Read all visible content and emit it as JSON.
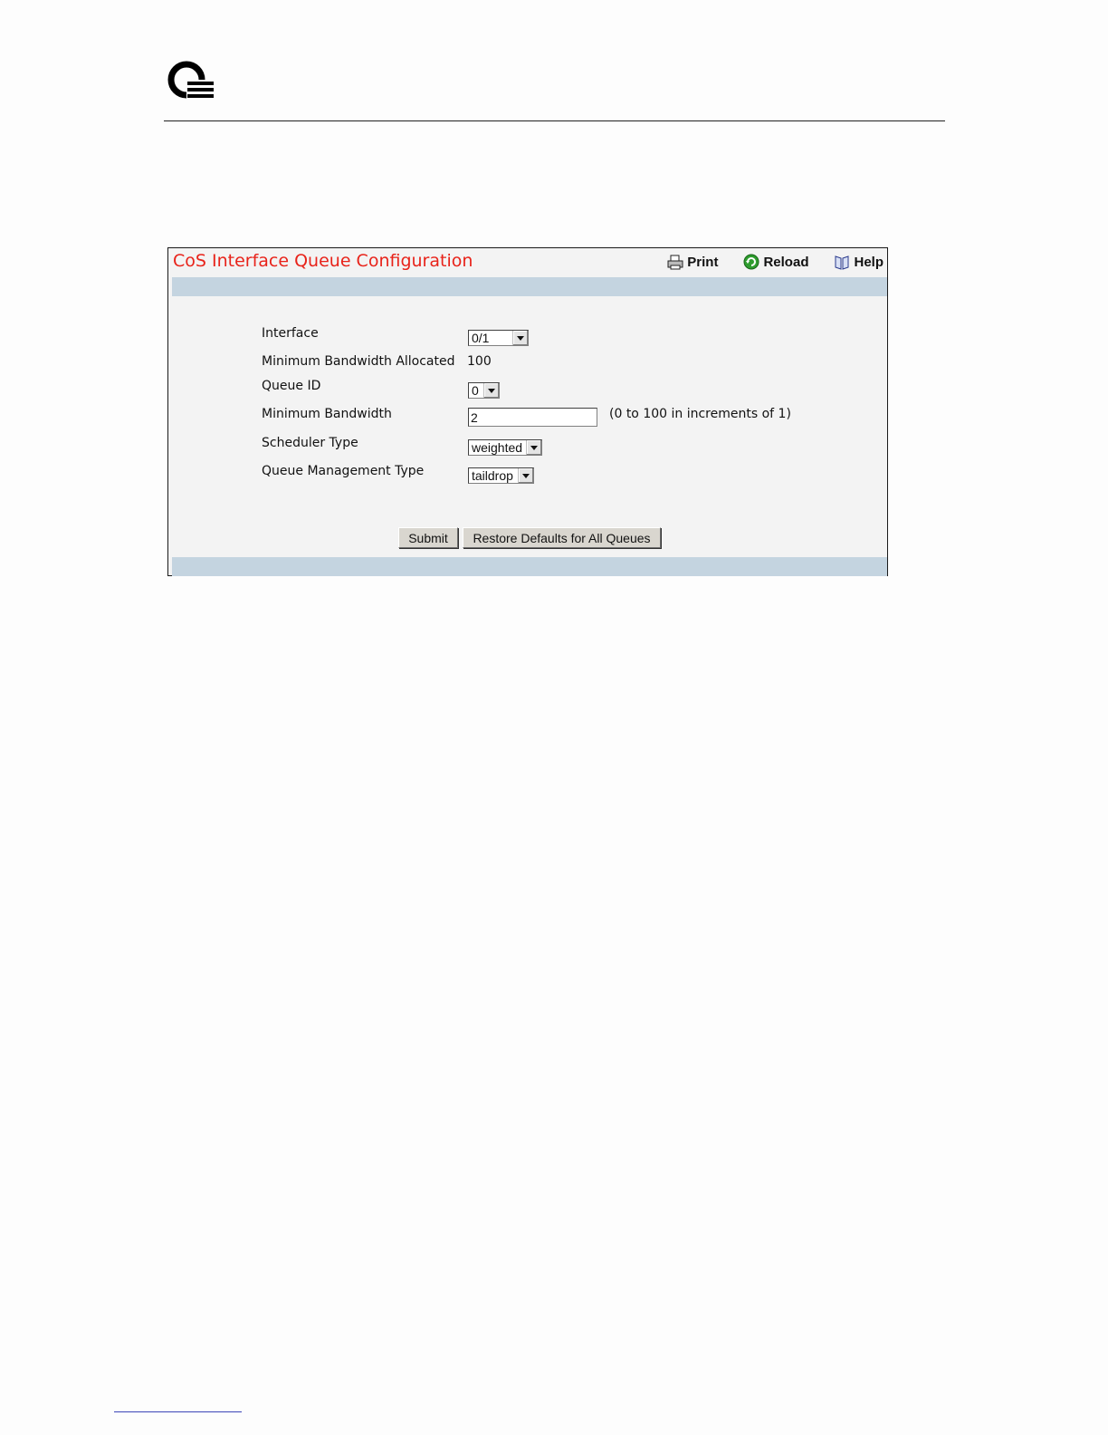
{
  "panel": {
    "title": "CoS Interface Queue Configuration",
    "tools": {
      "print": "Print",
      "reload": "Reload",
      "help": "Help"
    }
  },
  "form": {
    "interface": {
      "label": "Interface",
      "value": "0/1"
    },
    "min_bw_allocated": {
      "label": "Minimum Bandwidth Allocated",
      "value": "100"
    },
    "queue_id": {
      "label": "Queue ID",
      "value": "0"
    },
    "min_bw": {
      "label": "Minimum Bandwidth",
      "value": "2",
      "hint": "(0 to 100 in increments of 1)"
    },
    "scheduler_type": {
      "label": "Scheduler Type",
      "value": "weighted"
    },
    "queue_mgmt_type": {
      "label": "Queue Management Type",
      "value": "taildrop"
    }
  },
  "buttons": {
    "submit": "Submit",
    "restore": "Restore Defaults for All Queues"
  },
  "colors": {
    "title": "#e8231a",
    "band": "#c4d4e0",
    "panel_bg": "#f3f3f3"
  }
}
